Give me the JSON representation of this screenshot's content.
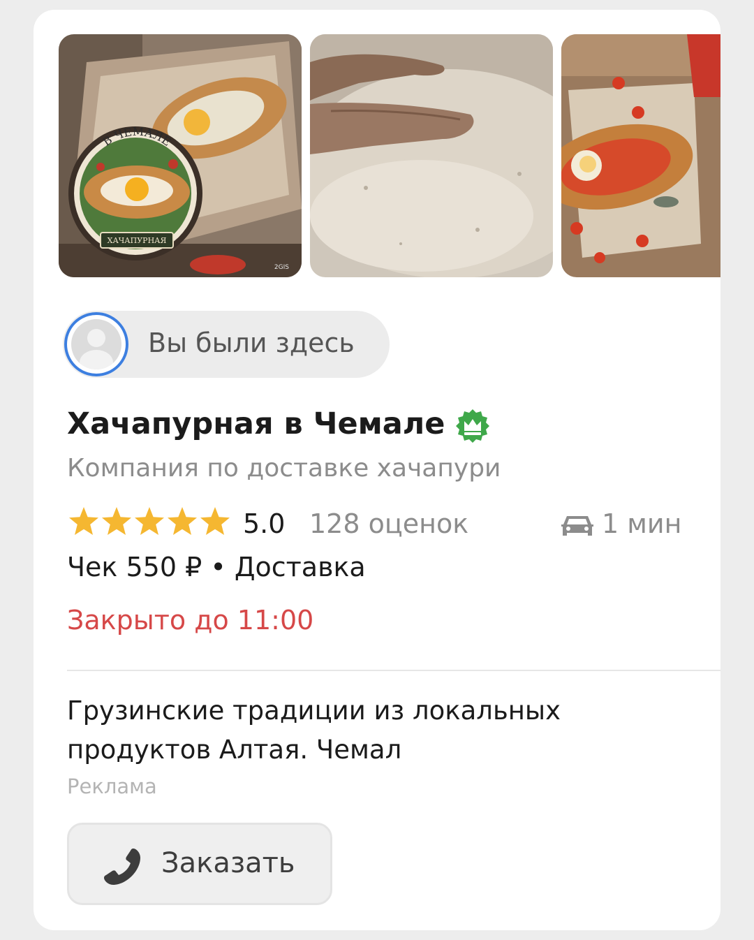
{
  "gallery": {
    "photos": [
      {
        "icon": "khachapuri-logo-photo",
        "logo_arc_text": "В ЧЕМАЛЕ",
        "logo_ribbon_text": "ХАЧАПУРНАЯ",
        "watermark": "2GIS"
      },
      {
        "icon": "dough-kneading-photo"
      },
      {
        "icon": "khachapuri-tomato-photo"
      }
    ]
  },
  "visited": {
    "label": "Вы были здесь",
    "icon": "user-avatar-icon"
  },
  "place": {
    "name": "Хачапурная в Чемале",
    "badge_icon": "verified-crown-badge-icon",
    "category": "Компания по доставке хачапури",
    "rating": {
      "stars": 5,
      "max_stars": 5,
      "value": "5.0",
      "count": "128 оценок"
    },
    "travel": {
      "icon": "car-icon",
      "time": "1 мин"
    },
    "price": "Чек 550 ₽ • Доставка",
    "status": "Закрыто до 11:00"
  },
  "ad": {
    "description": "Грузинские традиции из локальных продуктов Алтая. Чемал",
    "label": "Реклама"
  },
  "order_button": {
    "label": "Заказать",
    "icon": "phone-icon"
  },
  "colors": {
    "star": "#f5b731",
    "badge": "#3fa84a",
    "status_closed": "#d64848",
    "avatar_ring": "#3d7fe0"
  }
}
